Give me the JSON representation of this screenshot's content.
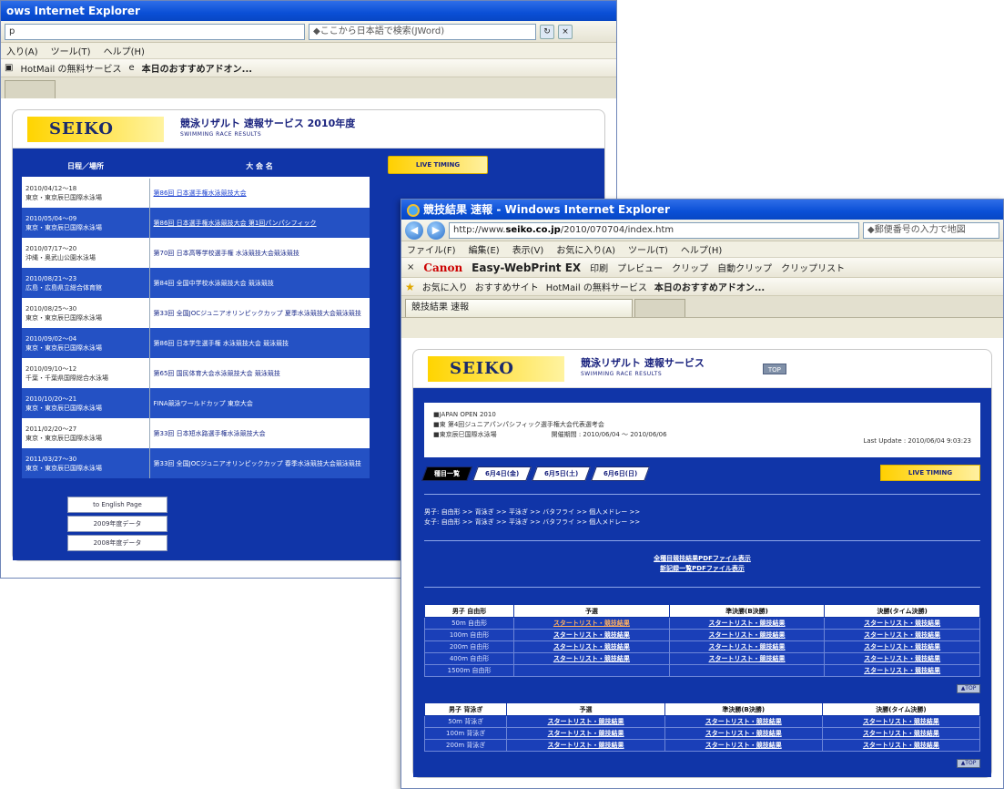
{
  "back": {
    "title": "ows Internet Explorer",
    "address": "p",
    "search": "◆ここから日本語で検索(JWord)",
    "menu": [
      "入り(A)",
      "ツール(T)",
      "ヘルプ(H)"
    ],
    "fav": [
      "HotMail の無料サービス",
      "本日のおすすめアドオン..."
    ],
    "header_title": "競泳リザルト 速報サービス 2010年度",
    "header_sub": "SWIMMING RACE RESULTS",
    "col_date": "日程／場所",
    "col_event": "大 会 名",
    "live_timing": "LIVE TIMING",
    "rows": [
      {
        "date": "2010/04/12〜18",
        "place": "東京・東京辰巳国際水泳場",
        "ev": "第86回 日本選手権水泳競技大会"
      },
      {
        "date": "2010/05/04〜09",
        "place": "東京・東京辰巳国際水泳場",
        "ev": "第86回 日本選手権水泳競技大会 第1回パンパシフィック"
      },
      {
        "date": "2010/07/17〜20",
        "place": "沖縄・奥武山公園水泳場",
        "ev": "第70回 日本高等学校選手権 水泳競技大会競泳競技"
      },
      {
        "date": "2010/08/21〜23",
        "place": "広島・広島県立総合体育館",
        "ev": "第84回 全国中学校水泳競技大会 競泳競技"
      },
      {
        "date": "2010/08/25〜30",
        "place": "東京・東京辰巳国際水泳場",
        "ev": "第33回 全国JOCジュニアオリンピックカップ 夏季水泳競技大会競泳競技"
      },
      {
        "date": "2010/09/02〜04",
        "place": "東京・東京辰巳国際水泳場",
        "ev": "第86回 日本学生選手権 水泳競技大会 競泳競技"
      },
      {
        "date": "2010/09/10〜12",
        "place": "千葉・千葉県国際総合水泳場",
        "ev": "第65回 国民体育大会水泳競技大会 競泳競技"
      },
      {
        "date": "2010/10/20〜21",
        "place": "東京・東京辰巳国際水泳場",
        "ev": "FINA競泳ワールドカップ 東京大会"
      },
      {
        "date": "2011/02/20〜27",
        "place": "東京・東京辰巳国際水泳場",
        "ev": "第33回 日本短水路選手権水泳競技大会"
      },
      {
        "date": "2011/03/27〜30",
        "place": "東京・東京辰巳国際水泳場",
        "ev": "第33回 全国JOCジュニアオリンピックカップ 春季水泳競技大会競泳競技"
      }
    ],
    "buttons": [
      "to English Page",
      "2009年度データ",
      "2008年度データ"
    ]
  },
  "front": {
    "title": "競技結果 速報 - Windows Internet Explorer",
    "address_prefix": "http://www.",
    "address_domain": "seiko.co.jp",
    "address_suffix": "/2010/070704/index.htm",
    "search": "◆郵便番号の入力で地図",
    "menu": [
      "ファイル(F)",
      "編集(E)",
      "表示(V)",
      "お気に入り(A)",
      "ツール(T)",
      "ヘルプ(H)"
    ],
    "toolbar": [
      "Canon",
      "Easy-WebPrint EX",
      "印刷",
      "プレビュー",
      "クリップ",
      "自動クリップ",
      "クリップリスト"
    ],
    "fav": [
      "お気に入り",
      "おすすめサイト",
      "HotMail の無料サービス",
      "本日のおすすめアドオン..."
    ],
    "tab": "競技結果 速報",
    "logo": "SEIKO",
    "header_title": "競泳リザルト 速報サービス",
    "header_sub": "SWIMMING RACE RESULTS",
    "top_btn": "TOP",
    "meet_name": "■JAPAN OPEN 2010",
    "meet_sub": "■東 第4回ジュニアパンパシフィック選手権大会代表選考会",
    "venue": "■東京辰巳国際水泳場",
    "period": "開催期間 : 2010/06/04 〜 2010/06/06",
    "last_update": "Last Update : 2010/06/04 9:03:23",
    "day_tabs": [
      "種目一覧",
      "6月4日(金)",
      "6月5日(土)",
      "6月6日(日)"
    ],
    "live_timing": "LIVE TIMING",
    "events_men": "男子: 自由形 >> 背泳ぎ >> 平泳ぎ >> バタフライ >> 個人メドレー >>",
    "events_women": "女子: 自由形 >> 背泳ぎ >> 平泳ぎ >> バタフライ >> 個人メドレー >>",
    "pdf1": "全種目競技結果PDFファイル表示",
    "pdf2": "新記録一覧PDFファイル表示",
    "table1": {
      "headers": [
        "男子 自由形",
        "予選",
        "準決勝(B決勝)",
        "決勝(タイム決勝)"
      ],
      "rows": [
        {
          "ev": "50m 自由形",
          "c": [
            "スタートリスト・競技結果",
            "スタートリスト・競技結果",
            "スタートリスト・競技結果"
          ]
        },
        {
          "ev": "100m 自由形",
          "c": [
            "スタートリスト・競技結果",
            "スタートリスト・競技結果",
            "スタートリスト・競技結果"
          ]
        },
        {
          "ev": "200m 自由形",
          "c": [
            "スタートリスト・競技結果",
            "スタートリスト・競技結果",
            "スタートリスト・競技結果"
          ]
        },
        {
          "ev": "400m 自由形",
          "c": [
            "スタートリスト・競技結果",
            "スタートリスト・競技結果",
            "スタートリスト・競技結果"
          ]
        },
        {
          "ev": "1500m 自由形",
          "c": [
            "",
            "",
            "スタートリスト・競技結果"
          ]
        }
      ]
    },
    "table2": {
      "headers": [
        "男子 背泳ぎ",
        "予選",
        "準決勝(B決勝)",
        "決勝(タイム決勝)"
      ],
      "rows": [
        {
          "ev": "50m 背泳ぎ",
          "c": [
            "スタートリスト・競技結果",
            "スタートリスト・競技結果",
            "スタートリスト・競技結果"
          ]
        },
        {
          "ev": "100m 背泳ぎ",
          "c": [
            "スタートリスト・競技結果",
            "スタートリスト・競技結果",
            "スタートリスト・競技結果"
          ]
        },
        {
          "ev": "200m 背泳ぎ",
          "c": [
            "スタートリスト・競技結果",
            "スタートリスト・競技結果",
            "スタートリスト・競技結果"
          ]
        }
      ]
    },
    "page_top": "▲TOP"
  }
}
